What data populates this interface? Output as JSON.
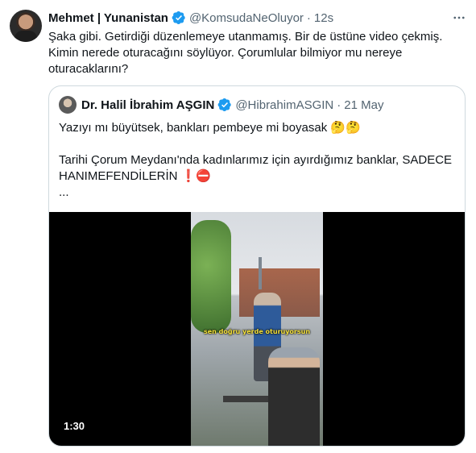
{
  "tweet": {
    "display_name": "Mehmet | Yunanistan",
    "handle": "@KomsudaNeOluyor",
    "separator": "·",
    "time": "12s",
    "text": "Şaka gibi. Getirdiği düzenlemeye utanmamış. Bir de üstüne video çekmiş. Kimin nerede oturacağını söylüyor. Çorumlular bilmiyor mu nereye oturacaklarını?",
    "more_icon": "more-horizontal-icon"
  },
  "quote": {
    "display_name": "Dr. Halil İbrahim AŞGIN",
    "handle": "@HibrahimASGIN",
    "separator": "·",
    "date": "21 May",
    "line1": "Yazıyı mı büyütsek, bankları pembeye mi boyasak 🤔🤔",
    "line2": "Tarihi Çorum Meydanı'nda kadınlarımız için ayırdığımız banklar, SADECE HANIMEFENDİLERİN ❗⛔",
    "line3": "...",
    "video": {
      "caption": "sen doğru yerde oturuyorsun",
      "duration": "1:30"
    }
  },
  "colors": {
    "verified_blue": "#1d9bf0",
    "muted_text": "#536471",
    "border": "#cfd9de"
  }
}
